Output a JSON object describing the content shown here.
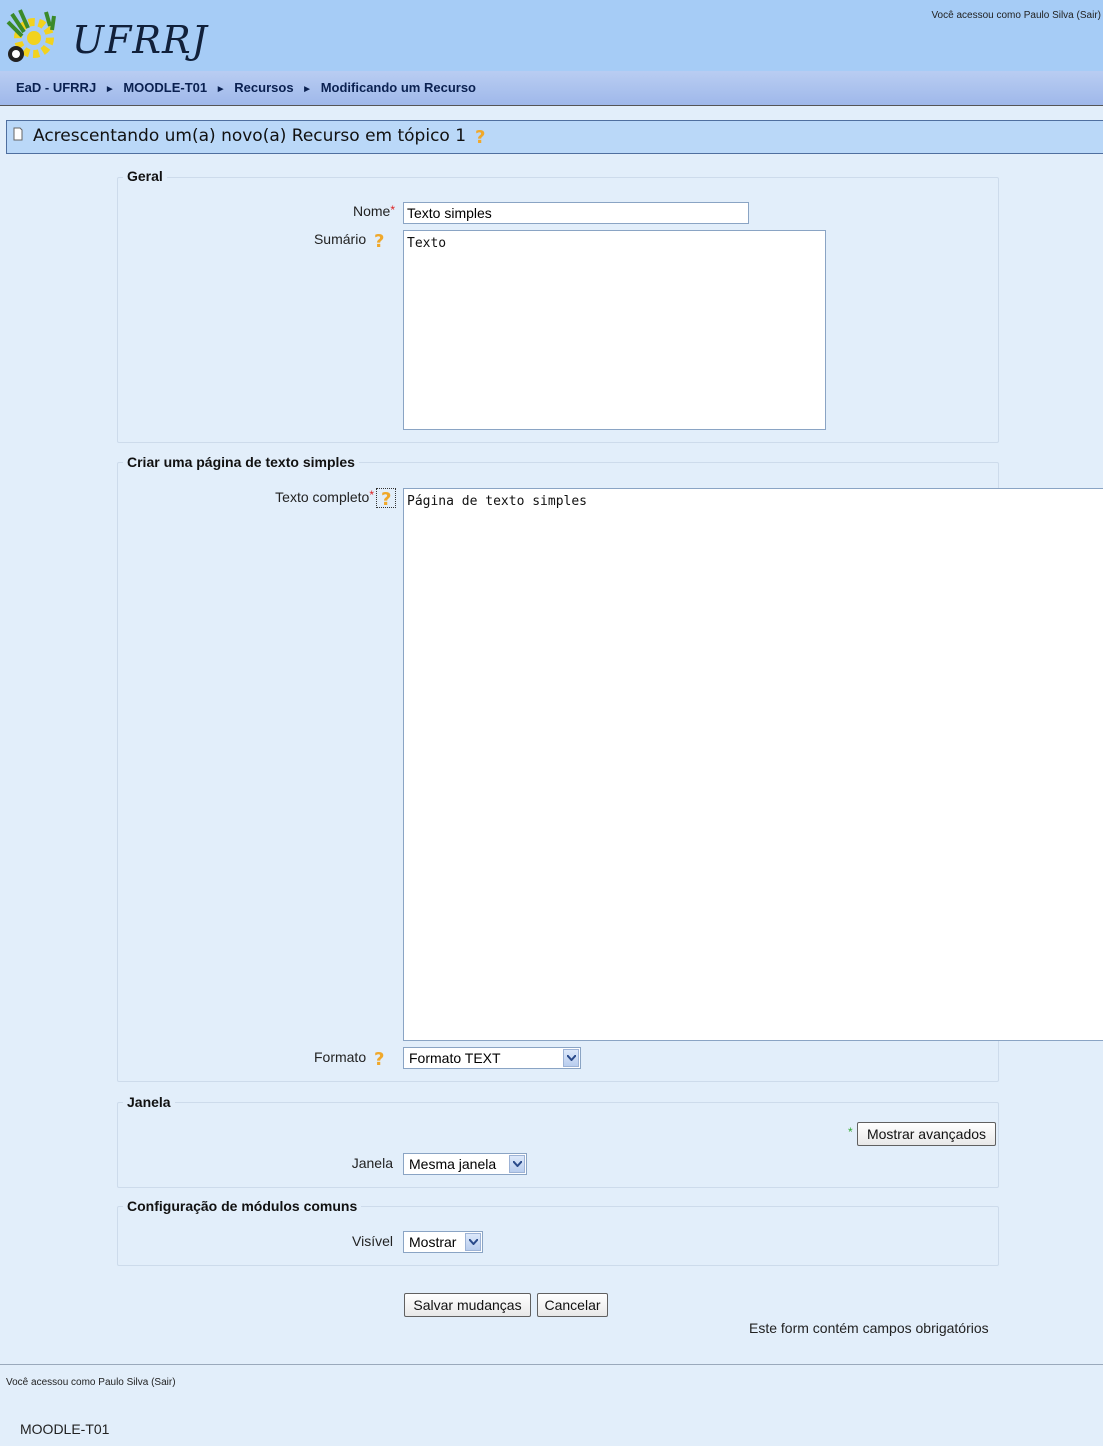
{
  "header": {
    "logo_text": "UFRRJ",
    "login_prefix": "Você acessou como Paulo Silva (",
    "logout_label": "Sair",
    "login_suffix": ")"
  },
  "breadcrumb": {
    "items": [
      "EaD - UFRRJ",
      "MOODLE-T01",
      "Recursos",
      "Modificando um Recurso"
    ],
    "separator": "►"
  },
  "page": {
    "title": "Acrescentando um(a) novo(a) Recurso em tópico 1"
  },
  "sections": {
    "geral": {
      "legend": "Geral",
      "name_label": "Nome",
      "name_value": "Texto simples",
      "summary_label": "Sumário",
      "summary_value": "Texto"
    },
    "texto": {
      "legend": "Criar uma página de texto simples",
      "full_text_label": "Texto completo",
      "full_text_value": "Página de texto simples",
      "format_label": "Formato",
      "format_value": "Formato TEXT"
    },
    "janela": {
      "legend": "Janela",
      "advanced_button": "Mostrar avançados",
      "window_label": "Janela",
      "window_value": "Mesma janela"
    },
    "modulos": {
      "legend": "Configuração de módulos comuns",
      "visible_label": "Visível",
      "visible_value": "Mostrar"
    }
  },
  "actions": {
    "save_label": "Salvar mudanças",
    "cancel_label": "Cancelar",
    "required_note": "Este form contém campos obrigatórios"
  },
  "footer": {
    "login_prefix": "Você acessou como Paulo Silva (",
    "logout_label": "Sair",
    "login_suffix": ")",
    "course_name": "MOODLE-T01"
  },
  "icons": {
    "help": "help-icon",
    "document": "document-icon",
    "dropdown": "chevron-down-icon"
  },
  "colors": {
    "header_bg": "#a6ccf6",
    "page_bg": "#e2eefa",
    "required_star": "#dd2222",
    "help_icon": "#f0a82a"
  }
}
